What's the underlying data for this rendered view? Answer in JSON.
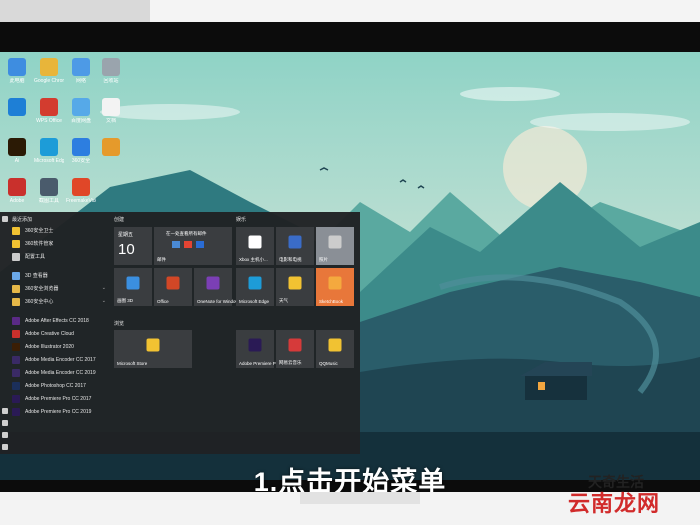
{
  "brand": "天奇",
  "desktop_icons": [
    {
      "label": "此电脑",
      "color": "#3e8de0"
    },
    {
      "label": "Google Chrome",
      "color": "#e8b53a"
    },
    {
      "label": "网络",
      "color": "#4d9ae6"
    },
    {
      "label": "回收站",
      "color": "#9aa4ad"
    },
    {
      "label": "",
      "color": "#1e7fd6"
    },
    {
      "label": "WPS Office",
      "color": "#d33c2f"
    },
    {
      "label": "百度网盘",
      "color": "#56a9e8"
    },
    {
      "label": "文档",
      "color": "#f3f3f3"
    },
    {
      "label": "Ai",
      "color": "#2b1a05"
    },
    {
      "label": "Microsoft Edge",
      "color": "#1d9cd8"
    },
    {
      "label": "360安全",
      "color": "#2d7ee0"
    },
    {
      "label": "",
      "color": "#e59a2b"
    },
    {
      "label": "Adobe",
      "color": "#c9302c"
    },
    {
      "label": "截图工具",
      "color": "#4a5b6c"
    },
    {
      "label": "FreemakeVideo",
      "color": "#e04728"
    }
  ],
  "start_menu": {
    "recent_header": "最近添加",
    "list": [
      {
        "label": "360安全卫士",
        "color": "#f1c232",
        "chev": false
      },
      {
        "label": "360软件管家",
        "color": "#f1c232",
        "chev": false
      },
      {
        "label": "配置工具",
        "color": "#cccccc",
        "chev": false
      },
      {
        "label": "3D 查看器",
        "color": "#6aa8e8",
        "chev": false
      },
      {
        "label": "360安全浏览器",
        "color": "#e6b848",
        "chev": true
      },
      {
        "label": "360安全中心",
        "color": "#e6b848",
        "chev": true
      },
      {
        "label": "Adobe After Effects CC 2018",
        "color": "#5a2a86",
        "chev": false
      },
      {
        "label": "Adobe Creative Cloud",
        "color": "#c9302c",
        "chev": false
      },
      {
        "label": "Adobe Illustrator 2020",
        "color": "#3a1e05",
        "chev": false
      },
      {
        "label": "Adobe Media Encoder CC 2017",
        "color": "#3a2a66",
        "chev": false
      },
      {
        "label": "Adobe Media Encoder CC 2019",
        "color": "#3a2a66",
        "chev": false
      },
      {
        "label": "Adobe Photoshop CC 2017",
        "color": "#1b2f5a",
        "chev": false
      },
      {
        "label": "Adobe Premiere Pro CC 2017",
        "color": "#2a1a55",
        "chev": false
      },
      {
        "label": "Adobe Premiere Pro CC 2019",
        "color": "#2a1a55",
        "chev": false
      }
    ],
    "groups": {
      "create": "创建",
      "play": "娱乐",
      "browse": "浏览"
    },
    "calendar": {
      "day": "星期五",
      "date": "10"
    },
    "mail_text": "在一处查看所有邮件",
    "tiles": [
      {
        "key": "mail",
        "label": "邮件",
        "icon": "#4a8ad4"
      },
      {
        "key": "xbox",
        "label": "Xbox 主机小...",
        "icon": "#ffffff"
      },
      {
        "key": "movies",
        "label": "电影和电视",
        "icon": "#3a6cc8"
      },
      {
        "key": "photos",
        "label": "照片",
        "icon": "#cccccc"
      },
      {
        "key": "paint3d",
        "label": "画图 3D",
        "icon": "#3b8fe0"
      },
      {
        "key": "office",
        "label": "Office",
        "icon": "#d24726"
      },
      {
        "key": "onenote",
        "label": "OneNote for Windows 10",
        "icon": "#7b3fb5"
      },
      {
        "key": "edge",
        "label": "Microsoft Edge",
        "icon": "#1d9cd8"
      },
      {
        "key": "weather",
        "label": "天气",
        "icon": "#f1c232"
      },
      {
        "key": "sketchbook",
        "label": "SketchBook",
        "icon": "#f4a93e"
      },
      {
        "key": "store",
        "label": "Microsoft Store",
        "icon": "#f1c232"
      },
      {
        "key": "premiere",
        "label": "Adobe Premiere Pro...",
        "icon": "#2a1a55"
      },
      {
        "key": "netease",
        "label": "网易云音乐",
        "icon": "#d63a3a"
      },
      {
        "key": "qqmusic",
        "label": "QQMusic",
        "icon": "#f1c232"
      }
    ]
  },
  "caption": "1.点击开始菜单",
  "watermark": {
    "line1": "天奇生活",
    "line2": "云南龙网"
  }
}
